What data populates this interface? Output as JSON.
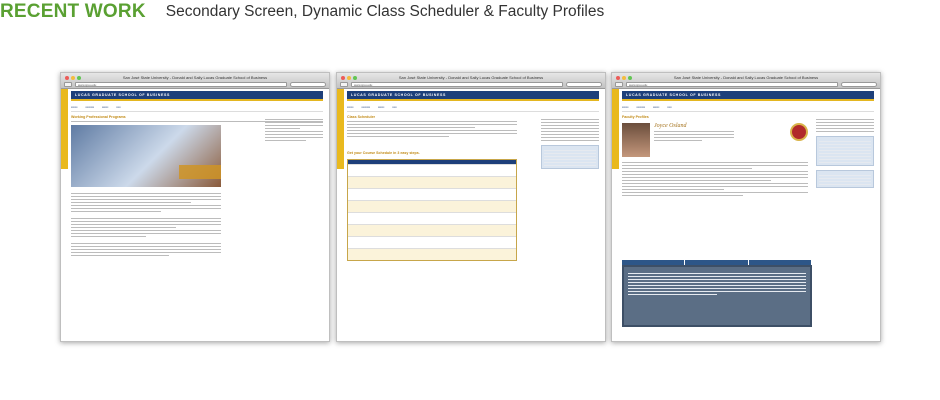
{
  "header": {
    "title": "RECENT WORK",
    "subtitle": "Secondary Screen, Dynamic Class Scheduler & Faculty Profiles"
  },
  "colors": {
    "title_green": "#5aa032",
    "sjsu_blue": "#1d3f7a",
    "sjsu_gold": "#e4b620"
  },
  "screens": [
    {
      "window_title": "San José State University - Donald and Sally Lucas Graduate School of Business",
      "url": "www.sjsu.edu",
      "banner": "LUCAS GRADUATE SCHOOL OF BUSINESS",
      "section_heading": "Working Professional Programs"
    },
    {
      "window_title": "San José State University - Donald and Sally Lucas Graduate School of Business",
      "url": "www.sjsu.edu",
      "banner": "LUCAS GRADUATE SCHOOL OF BUSINESS",
      "section_heading": "Class Scheduler",
      "table_heading": "Get your Course Schedule in 3 easy steps."
    },
    {
      "window_title": "San José State University - Donald and Sally Lucas Graduate School of Business",
      "url": "www.sjsu.edu",
      "banner": "LUCAS GRADUATE SCHOOL OF BUSINESS",
      "section_heading": "Faculty Profiles",
      "profile_name": "Joyce Osland"
    }
  ]
}
